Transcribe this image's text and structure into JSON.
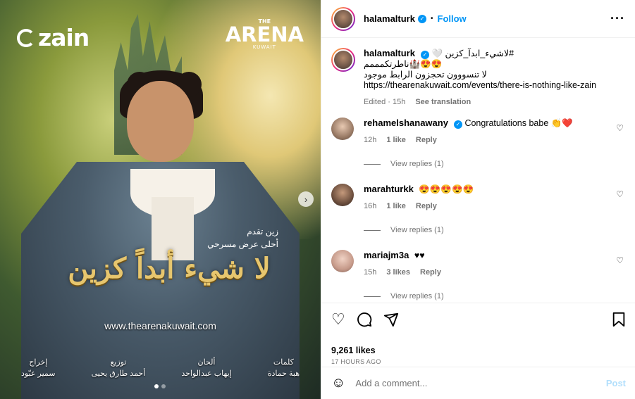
{
  "media": {
    "logo_left": "zain",
    "logo_right_top": "THE",
    "logo_right_name": "ARENA",
    "logo_right_sub": "KUWAIT",
    "presents_line1": "زين تقدم",
    "presents_line2": "أحلى عرض مسرحي",
    "show_title": "لا شيء أبداً كزين",
    "website": "www.thearenakuwait.com",
    "credits": [
      {
        "role": "كلمات",
        "name": "هبة حمادة"
      },
      {
        "role": "ألحان",
        "name": "إيهاب عبدالواحد"
      },
      {
        "role": "توزيع",
        "name": "أحمد طارق يحيى"
      },
      {
        "role": "إخراج",
        "name": "سمير عبّود"
      }
    ],
    "next_icon": "chevron-right-icon",
    "slide_count": 2,
    "active_slide": 1
  },
  "header": {
    "username": "halamalturk",
    "separator": "•",
    "follow_label": "Follow",
    "more_icon": "more-horizontal-icon"
  },
  "caption": {
    "username": "halamalturk",
    "line1": "#لاشيء_ابدآ_كزين 🤍",
    "line2": "😍😍🏰ناطرتكمممم",
    "line3": "لا تنسووون تحجزون الرابط موجود",
    "line4": "https://thearenakuwait.com/events/there-is-nothing-like-zain",
    "edited": "Edited · 15h",
    "see_translation": "See translation"
  },
  "comments": [
    {
      "username": "rehamelshanawany",
      "verified": true,
      "text": "Congratulations babe 👏❤️",
      "time": "12h",
      "likes": "1 like",
      "reply": "Reply",
      "view_replies": "View replies (1)"
    },
    {
      "username": "marahturkk",
      "verified": false,
      "text": "😍😍😍😍😍",
      "time": "16h",
      "likes": "1 like",
      "reply": "Reply",
      "view_replies": "View replies (1)"
    },
    {
      "username": "mariajm3a",
      "verified": false,
      "text": "♥♥",
      "time": "15h",
      "likes": "3 likes",
      "reply": "Reply",
      "view_replies": "View replies (1)"
    }
  ],
  "actions": {
    "like_icon": "heart-icon",
    "comment_icon": "comment-icon",
    "share_icon": "send-icon",
    "save_icon": "bookmark-icon",
    "likes": "9,261 likes",
    "time_ago": "17 HOURS AGO"
  },
  "add_comment": {
    "placeholder": "Add a comment...",
    "post_label": "Post",
    "emoji_icon": "smiley-icon"
  },
  "colors": {
    "accent": "#0095f6",
    "muted": "#737373",
    "post_disabled": "#b2dffc",
    "border": "#efefef"
  }
}
